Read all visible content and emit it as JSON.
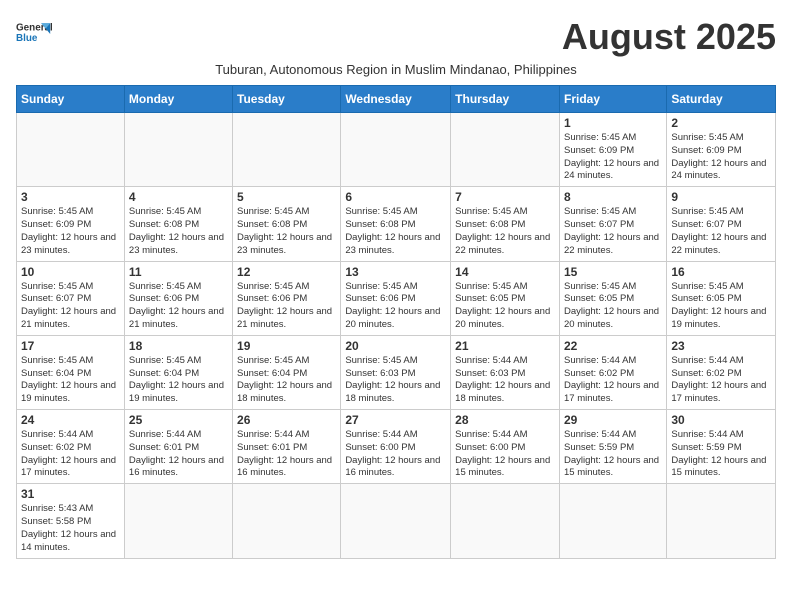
{
  "header": {
    "logo_general": "General",
    "logo_blue": "Blue",
    "month_title": "August 2025",
    "subtitle": "Tuburan, Autonomous Region in Muslim Mindanao, Philippines"
  },
  "days_of_week": [
    "Sunday",
    "Monday",
    "Tuesday",
    "Wednesday",
    "Thursday",
    "Friday",
    "Saturday"
  ],
  "weeks": [
    [
      {
        "day": "",
        "info": ""
      },
      {
        "day": "",
        "info": ""
      },
      {
        "day": "",
        "info": ""
      },
      {
        "day": "",
        "info": ""
      },
      {
        "day": "",
        "info": ""
      },
      {
        "day": "1",
        "info": "Sunrise: 5:45 AM\nSunset: 6:09 PM\nDaylight: 12 hours and 24 minutes."
      },
      {
        "day": "2",
        "info": "Sunrise: 5:45 AM\nSunset: 6:09 PM\nDaylight: 12 hours and 24 minutes."
      }
    ],
    [
      {
        "day": "3",
        "info": "Sunrise: 5:45 AM\nSunset: 6:09 PM\nDaylight: 12 hours and 23 minutes."
      },
      {
        "day": "4",
        "info": "Sunrise: 5:45 AM\nSunset: 6:08 PM\nDaylight: 12 hours and 23 minutes."
      },
      {
        "day": "5",
        "info": "Sunrise: 5:45 AM\nSunset: 6:08 PM\nDaylight: 12 hours and 23 minutes."
      },
      {
        "day": "6",
        "info": "Sunrise: 5:45 AM\nSunset: 6:08 PM\nDaylight: 12 hours and 23 minutes."
      },
      {
        "day": "7",
        "info": "Sunrise: 5:45 AM\nSunset: 6:08 PM\nDaylight: 12 hours and 22 minutes."
      },
      {
        "day": "8",
        "info": "Sunrise: 5:45 AM\nSunset: 6:07 PM\nDaylight: 12 hours and 22 minutes."
      },
      {
        "day": "9",
        "info": "Sunrise: 5:45 AM\nSunset: 6:07 PM\nDaylight: 12 hours and 22 minutes."
      }
    ],
    [
      {
        "day": "10",
        "info": "Sunrise: 5:45 AM\nSunset: 6:07 PM\nDaylight: 12 hours and 21 minutes."
      },
      {
        "day": "11",
        "info": "Sunrise: 5:45 AM\nSunset: 6:06 PM\nDaylight: 12 hours and 21 minutes."
      },
      {
        "day": "12",
        "info": "Sunrise: 5:45 AM\nSunset: 6:06 PM\nDaylight: 12 hours and 21 minutes."
      },
      {
        "day": "13",
        "info": "Sunrise: 5:45 AM\nSunset: 6:06 PM\nDaylight: 12 hours and 20 minutes."
      },
      {
        "day": "14",
        "info": "Sunrise: 5:45 AM\nSunset: 6:05 PM\nDaylight: 12 hours and 20 minutes."
      },
      {
        "day": "15",
        "info": "Sunrise: 5:45 AM\nSunset: 6:05 PM\nDaylight: 12 hours and 20 minutes."
      },
      {
        "day": "16",
        "info": "Sunrise: 5:45 AM\nSunset: 6:05 PM\nDaylight: 12 hours and 19 minutes."
      }
    ],
    [
      {
        "day": "17",
        "info": "Sunrise: 5:45 AM\nSunset: 6:04 PM\nDaylight: 12 hours and 19 minutes."
      },
      {
        "day": "18",
        "info": "Sunrise: 5:45 AM\nSunset: 6:04 PM\nDaylight: 12 hours and 19 minutes."
      },
      {
        "day": "19",
        "info": "Sunrise: 5:45 AM\nSunset: 6:04 PM\nDaylight: 12 hours and 18 minutes."
      },
      {
        "day": "20",
        "info": "Sunrise: 5:45 AM\nSunset: 6:03 PM\nDaylight: 12 hours and 18 minutes."
      },
      {
        "day": "21",
        "info": "Sunrise: 5:44 AM\nSunset: 6:03 PM\nDaylight: 12 hours and 18 minutes."
      },
      {
        "day": "22",
        "info": "Sunrise: 5:44 AM\nSunset: 6:02 PM\nDaylight: 12 hours and 17 minutes."
      },
      {
        "day": "23",
        "info": "Sunrise: 5:44 AM\nSunset: 6:02 PM\nDaylight: 12 hours and 17 minutes."
      }
    ],
    [
      {
        "day": "24",
        "info": "Sunrise: 5:44 AM\nSunset: 6:02 PM\nDaylight: 12 hours and 17 minutes."
      },
      {
        "day": "25",
        "info": "Sunrise: 5:44 AM\nSunset: 6:01 PM\nDaylight: 12 hours and 16 minutes."
      },
      {
        "day": "26",
        "info": "Sunrise: 5:44 AM\nSunset: 6:01 PM\nDaylight: 12 hours and 16 minutes."
      },
      {
        "day": "27",
        "info": "Sunrise: 5:44 AM\nSunset: 6:00 PM\nDaylight: 12 hours and 16 minutes."
      },
      {
        "day": "28",
        "info": "Sunrise: 5:44 AM\nSunset: 6:00 PM\nDaylight: 12 hours and 15 minutes."
      },
      {
        "day": "29",
        "info": "Sunrise: 5:44 AM\nSunset: 5:59 PM\nDaylight: 12 hours and 15 minutes."
      },
      {
        "day": "30",
        "info": "Sunrise: 5:44 AM\nSunset: 5:59 PM\nDaylight: 12 hours and 15 minutes."
      }
    ],
    [
      {
        "day": "31",
        "info": "Sunrise: 5:43 AM\nSunset: 5:58 PM\nDaylight: 12 hours and 14 minutes."
      },
      {
        "day": "",
        "info": ""
      },
      {
        "day": "",
        "info": ""
      },
      {
        "day": "",
        "info": ""
      },
      {
        "day": "",
        "info": ""
      },
      {
        "day": "",
        "info": ""
      },
      {
        "day": "",
        "info": ""
      }
    ]
  ]
}
